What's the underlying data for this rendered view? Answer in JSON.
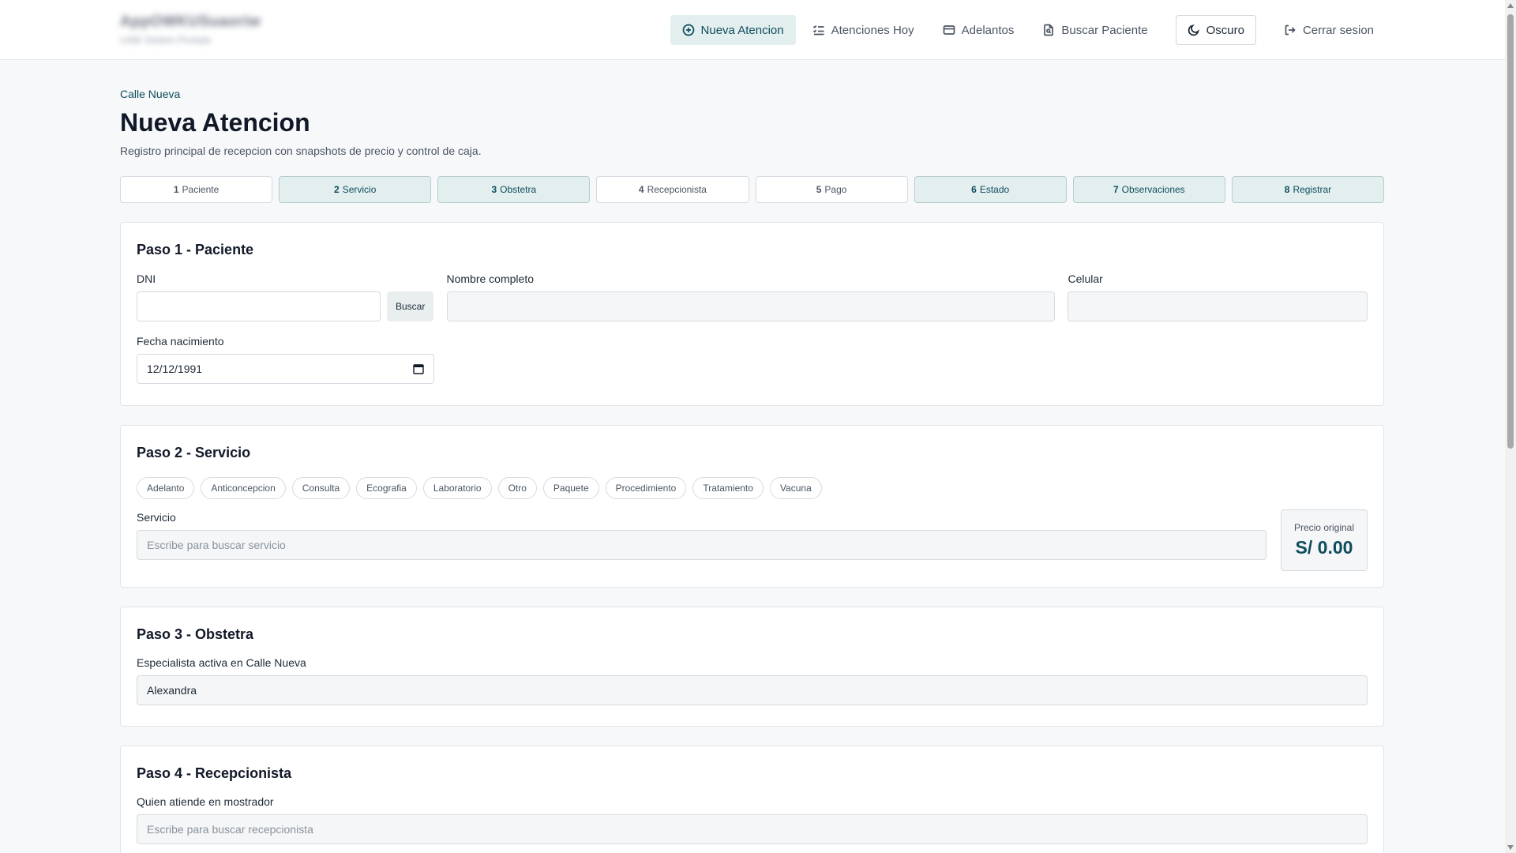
{
  "header": {
    "brand_title": "AppOWKUSuaoriw",
    "brand_sub": "UAB Sistem Portala",
    "nav": [
      {
        "label": "Nueva Atencion",
        "icon": "plus-circle-icon"
      },
      {
        "label": "Atenciones Hoy",
        "icon": "list-check-icon"
      },
      {
        "label": "Adelantos",
        "icon": "credit-card-icon"
      },
      {
        "label": "Buscar Paciente",
        "icon": "file-search-icon"
      },
      {
        "label": "Oscuro",
        "icon": "moon-icon"
      },
      {
        "label": "Cerrar sesion",
        "icon": "logout-icon"
      }
    ]
  },
  "page": {
    "breadcrumb": "Calle Nueva",
    "title": "Nueva Atencion",
    "subtitle": "Registro principal de recepcion con snapshots de precio y control de caja."
  },
  "steps": [
    {
      "num": "1",
      "label": "Paciente"
    },
    {
      "num": "2",
      "label": "Servicio"
    },
    {
      "num": "3",
      "label": "Obstetra"
    },
    {
      "num": "4",
      "label": "Recepcionista"
    },
    {
      "num": "5",
      "label": "Pago"
    },
    {
      "num": "6",
      "label": "Estado"
    },
    {
      "num": "7",
      "label": "Observaciones"
    },
    {
      "num": "8",
      "label": "Registrar"
    }
  ],
  "paciente": {
    "title": "Paso 1 - Paciente",
    "dni_label": "DNI",
    "dni_value": "",
    "buscar_label": "Buscar",
    "nombre_label": "Nombre completo",
    "nombre_value": "",
    "celular_label": "Celular",
    "celular_value": "",
    "fecha_label": "Fecha nacimiento",
    "fecha_value": "12/12/1991"
  },
  "servicio": {
    "title": "Paso 2 - Servicio",
    "chips": [
      "Adelanto",
      "Anticoncepcion",
      "Consulta",
      "Ecografia",
      "Laboratorio",
      "Otro",
      "Paquete",
      "Procedimiento",
      "Tratamiento",
      "Vacuna"
    ],
    "servicio_label": "Servicio",
    "servicio_placeholder": "Escribe para buscar servicio",
    "precio_label": "Precio original",
    "precio_value": "S/ 0.00"
  },
  "obstetra": {
    "title": "Paso 3 - Obstetra",
    "label": "Especialista activa en Calle Nueva",
    "value": "Alexandra"
  },
  "recepcionista": {
    "title": "Paso 4 - Recepcionista",
    "label": "Quien atiende en mostrador",
    "placeholder": "Escribe para buscar recepcionista"
  },
  "colors": {
    "accent": "#0f4c5c",
    "accent_bg": "#e3efef",
    "page_bg": "#f6f8f9"
  }
}
